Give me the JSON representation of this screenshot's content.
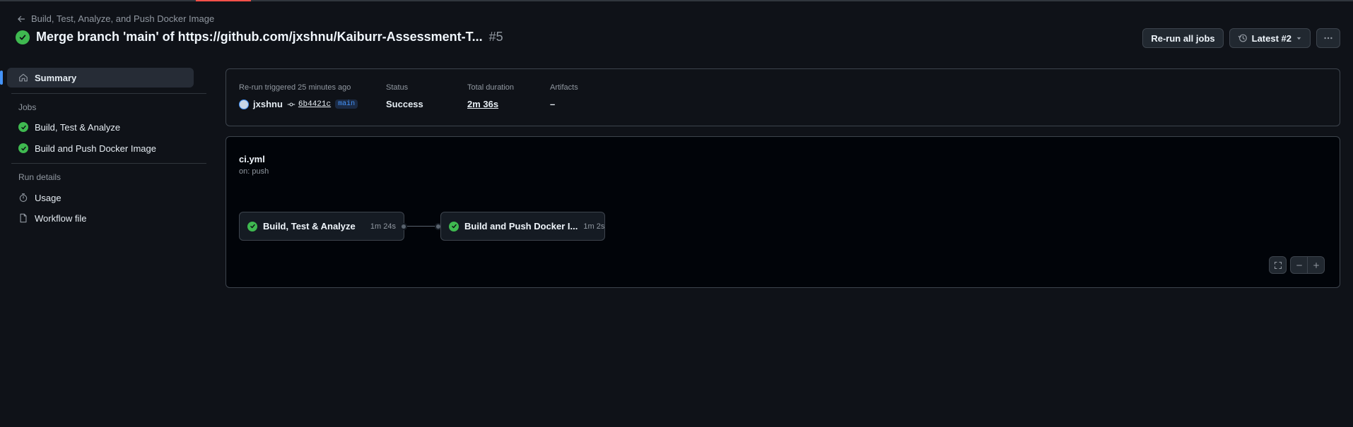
{
  "header": {
    "back_label": "Build, Test, Analyze, and Push Docker Image",
    "title": "Merge branch 'main' of https://github.com/jxshnu/Kaiburr-Assessment-T...",
    "run_number": "#5",
    "rerun_label": "Re-run all jobs",
    "attempt_label": "Latest #2"
  },
  "sidebar": {
    "summary_label": "Summary",
    "jobs_heading": "Jobs",
    "jobs": [
      {
        "label": "Build, Test & Analyze"
      },
      {
        "label": "Build and Push Docker Image"
      }
    ],
    "run_details_heading": "Run details",
    "usage_label": "Usage",
    "workflow_file_label": "Workflow file"
  },
  "summary": {
    "trigger_label": "Re-run triggered 25 minutes ago",
    "user": "jxshnu",
    "commit": "6b4421c",
    "branch": "main",
    "status_label": "Status",
    "status_value": "Success",
    "duration_label": "Total duration",
    "duration_value": "2m 36s",
    "artifacts_label": "Artifacts",
    "artifacts_value": "–"
  },
  "graph": {
    "file": "ci.yml",
    "trigger": "on: push",
    "jobs": [
      {
        "name": "Build, Test & Analyze",
        "time": "1m 24s"
      },
      {
        "name": "Build and Push Docker I...",
        "time": "1m 2s"
      }
    ]
  },
  "colors": {
    "success": "#3fb950",
    "accent": "#4493f8",
    "background": "#0f1218",
    "graph_background": "#010409"
  }
}
